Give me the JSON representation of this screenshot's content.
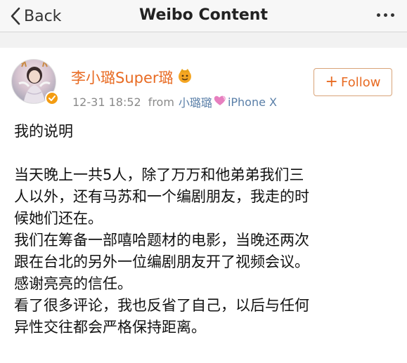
{
  "navbar": {
    "back_label": "Back",
    "title": "Weibo Content",
    "more_icon": "more-dots-icon"
  },
  "post": {
    "user_name": "李小璐Super璐",
    "timestamp": "12-31 18:52",
    "from_label": "from",
    "source_name": "小璐璐",
    "device": "iPhone X",
    "follow_label": "Follow",
    "follow_plus": "+",
    "content": {
      "title": "我的说明",
      "lines": [
        "当天晚上一共5人，除了万万和他弟弟我们三",
        "人以外，还有马苏和一个编剧朋友，我走的时",
        "候她们还在。",
        "我们在筹备一部嘻哈题材的电影，当晚还两次",
        "跟在台北的另外一位编剧朋友开了视频会议。",
        "感谢亮亮的信任。",
        "看了很多评论，我也反省了自己，以后与任何",
        "异性交往都会严格保持距离。"
      ]
    }
  },
  "colors": {
    "accent_orange": "#e86b23",
    "link_blue": "#5a7fa8",
    "verified_badge": "#f39c12"
  }
}
